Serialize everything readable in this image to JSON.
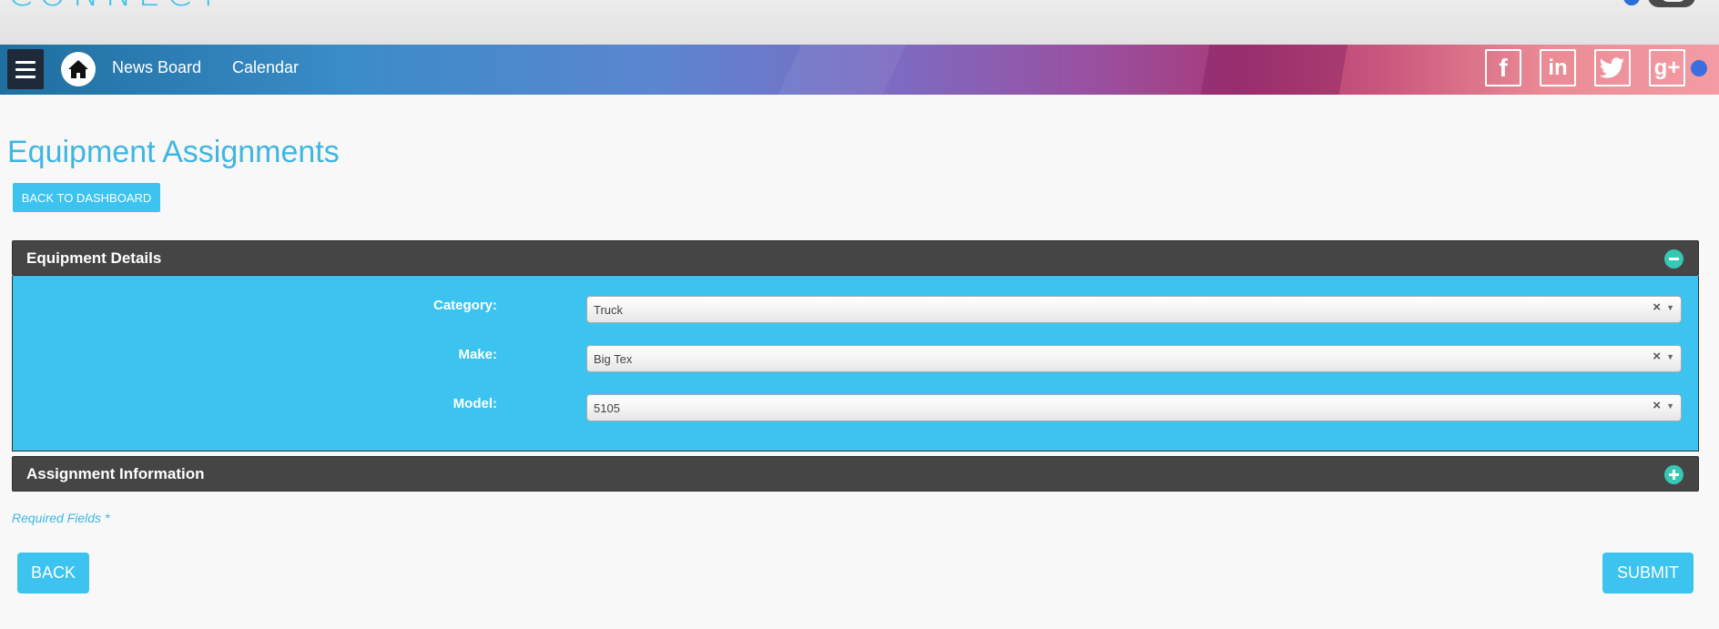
{
  "top": {
    "logo_fragment": "CONNECT"
  },
  "nav": {
    "links": [
      "News Board",
      "Calendar"
    ],
    "social": {
      "facebook": "f",
      "linkedin": "in",
      "googleplus": "g+"
    },
    "icons": [
      "menu-icon",
      "home-icon",
      "facebook-icon",
      "linkedin-icon",
      "twitter-icon",
      "google-plus-icon"
    ]
  },
  "page": {
    "title": "Equipment Assignments",
    "back_to_dashboard": "BACK TO DASHBOARD"
  },
  "panels": {
    "equipment": {
      "title": "Equipment Details",
      "fields": [
        {
          "label": "Category:",
          "value": "Truck"
        },
        {
          "label": "Make:",
          "value": "Big Tex"
        },
        {
          "label": "Model:",
          "value": "5105"
        }
      ],
      "clear_glyph": "×",
      "arrow_glyph": "▼"
    },
    "assignment": {
      "title": "Assignment Information"
    }
  },
  "footer": {
    "required_note": "Required Fields *",
    "back_label": "BACK",
    "submit_label": "SUBMIT"
  },
  "colors": {
    "accent": "#3cc3ef",
    "title": "#3fb6e2",
    "panel_header": "#454545",
    "toggle": "#35c8b4"
  }
}
